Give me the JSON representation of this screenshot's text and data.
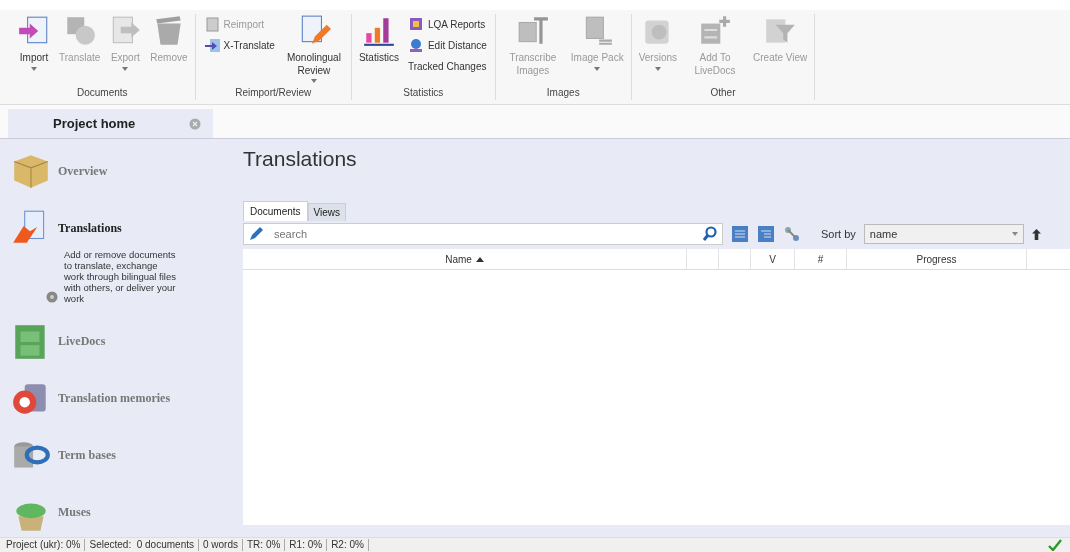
{
  "ribbon": {
    "groups": [
      {
        "label": "Documents",
        "items": [
          {
            "kind": "large",
            "label": "Import",
            "disabled": false,
            "dropdown": true
          },
          {
            "kind": "large",
            "label": "Translate",
            "disabled": true,
            "dropdown": false
          },
          {
            "kind": "large",
            "label": "Export",
            "disabled": true,
            "dropdown": true
          },
          {
            "kind": "large",
            "label": "Remove",
            "disabled": true,
            "dropdown": false
          }
        ]
      },
      {
        "label": "Reimport/Review",
        "items": [
          {
            "kind": "stack",
            "items": [
              {
                "label": "Reimport",
                "disabled": true
              },
              {
                "label": "X-Translate",
                "disabled": false
              }
            ]
          },
          {
            "kind": "large",
            "label": "Monolingual Review",
            "disabled": false,
            "dropdown": true
          }
        ]
      },
      {
        "label": "Statistics",
        "items": [
          {
            "kind": "large",
            "label": "Statistics",
            "disabled": false,
            "dropdown": false
          },
          {
            "kind": "stack",
            "items": [
              {
                "label": "LQA Reports",
                "disabled": false
              },
              {
                "label": "Edit Distance",
                "disabled": false
              },
              {
                "label": "Tracked Changes",
                "disabled": false
              }
            ]
          }
        ]
      },
      {
        "label": "Images",
        "items": [
          {
            "kind": "large",
            "label": "Transcribe Images",
            "disabled": true,
            "dropdown": false
          },
          {
            "kind": "large",
            "label": "Image Pack",
            "disabled": true,
            "dropdown": true
          }
        ]
      },
      {
        "label": "Other",
        "items": [
          {
            "kind": "large",
            "label": "Versions",
            "disabled": true,
            "dropdown": true
          },
          {
            "kind": "large",
            "label": "Add To LiveDocs",
            "disabled": true,
            "dropdown": false
          },
          {
            "kind": "large",
            "label": "Create View",
            "disabled": true,
            "dropdown": false
          }
        ]
      }
    ]
  },
  "tab": {
    "label": "Project home"
  },
  "sidebar": {
    "items": [
      {
        "label": "Overview",
        "selected": false
      },
      {
        "label": "Translations",
        "selected": true,
        "description": "Add or remove documents to translate, exchange work through bilingual files with others, or deliver your work"
      },
      {
        "label": "LiveDocs",
        "selected": false
      },
      {
        "label": "Translation memories",
        "selected": false
      },
      {
        "label": "Term bases",
        "selected": false
      },
      {
        "label": "Muses",
        "selected": false
      }
    ]
  },
  "main": {
    "title": "Translations",
    "tabs": [
      {
        "label": "Documents",
        "selected": true
      },
      {
        "label": "Views",
        "selected": false
      }
    ],
    "search": {
      "placeholder": "search"
    },
    "sort": {
      "label": "Sort by",
      "value": "name"
    },
    "table": {
      "columns": [
        {
          "label": "Name",
          "sorted": true
        },
        {
          "label": "V",
          "sorted": false
        },
        {
          "label": "#",
          "sorted": false
        },
        {
          "label": "Progress",
          "sorted": false
        }
      ]
    }
  },
  "status_bar": [
    "Project (ukr): 0%",
    "Selected:  0 documents",
    "0 words",
    "TR: 0%",
    "R1: 0%",
    "R2: 0%"
  ]
}
